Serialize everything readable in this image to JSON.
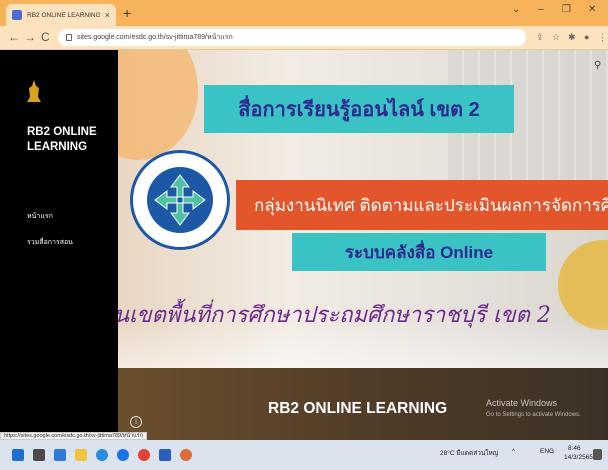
{
  "browser": {
    "tab_title": "RB2 ONLINE LEARNING",
    "tab_close": "×",
    "new_tab": "+",
    "url": "sites.google.com/esdc.go.th/sv-jittima789/หน้าแรก",
    "window_controls": [
      "⌄",
      "–",
      "❐",
      "✕"
    ],
    "nav": [
      "←",
      "→",
      "C"
    ],
    "accent": "#f7b35a"
  },
  "sidebar": {
    "site_name": "RB2 ONLINE LEARNING",
    "items": [
      "หน้าแรก",
      "รวมสื่อการสอน"
    ]
  },
  "hero": {
    "heading": "สื่อการเรียนรู้ออนไลน์ เขต 2",
    "group": "กลุ่มงานนิเทศ ติดตามและประเมินผลการจัดการศึ",
    "system": "ระบบคลังสื่อ Online",
    "area": "นเขตพื้นที่การศึกษาประถมศึกษาราชบุรี เขต 2",
    "search_icon": "search-icon"
  },
  "footer_band": {
    "title": "RB2 ONLINE LEARNING",
    "activate_title": "Activate Windows",
    "activate_sub": "Go to Settings to activate Windows.",
    "info_icon": "i"
  },
  "status_url": "https://sites.google.com/esdc.go.th/sv-jittima789/หน้าแรก",
  "taskbar": {
    "weather": "28°C มีแดดส่วนใหญ่",
    "lang": "ENG",
    "time": "8:46",
    "date": "14/3/2565"
  }
}
